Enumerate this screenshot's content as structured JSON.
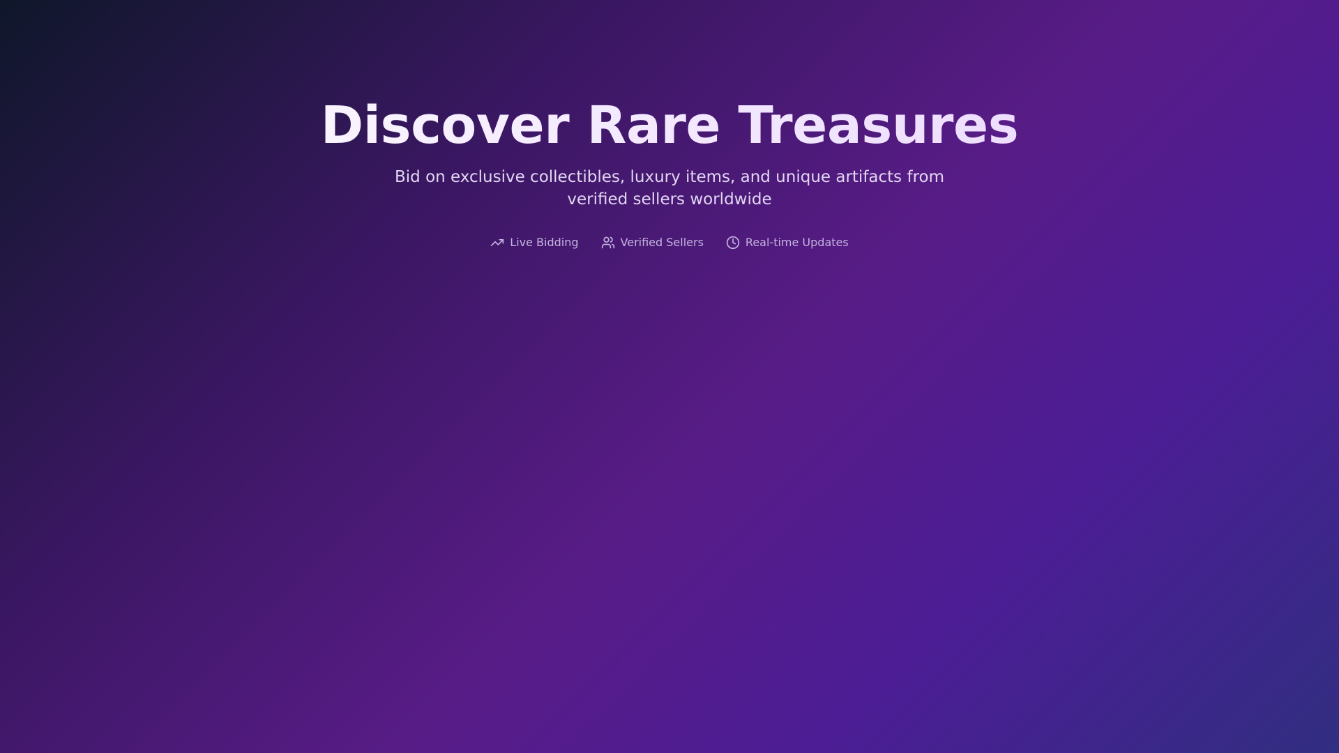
{
  "hero": {
    "title": "Discover Rare Treasures",
    "subtitle": "Bid on exclusive collectibles, luxury items, and unique artifacts from verified sellers worldwide"
  },
  "features": [
    {
      "icon": "trending-up-icon",
      "label": "Live Bidding"
    },
    {
      "icon": "users-icon",
      "label": "Verified Sellers"
    },
    {
      "icon": "clock-icon",
      "label": "Real-time Updates"
    }
  ],
  "colors": {
    "background_start": "#0f172a",
    "background_mid": "#581c87",
    "background_end": "#312e81",
    "feature_text": "#c4b5e0"
  }
}
